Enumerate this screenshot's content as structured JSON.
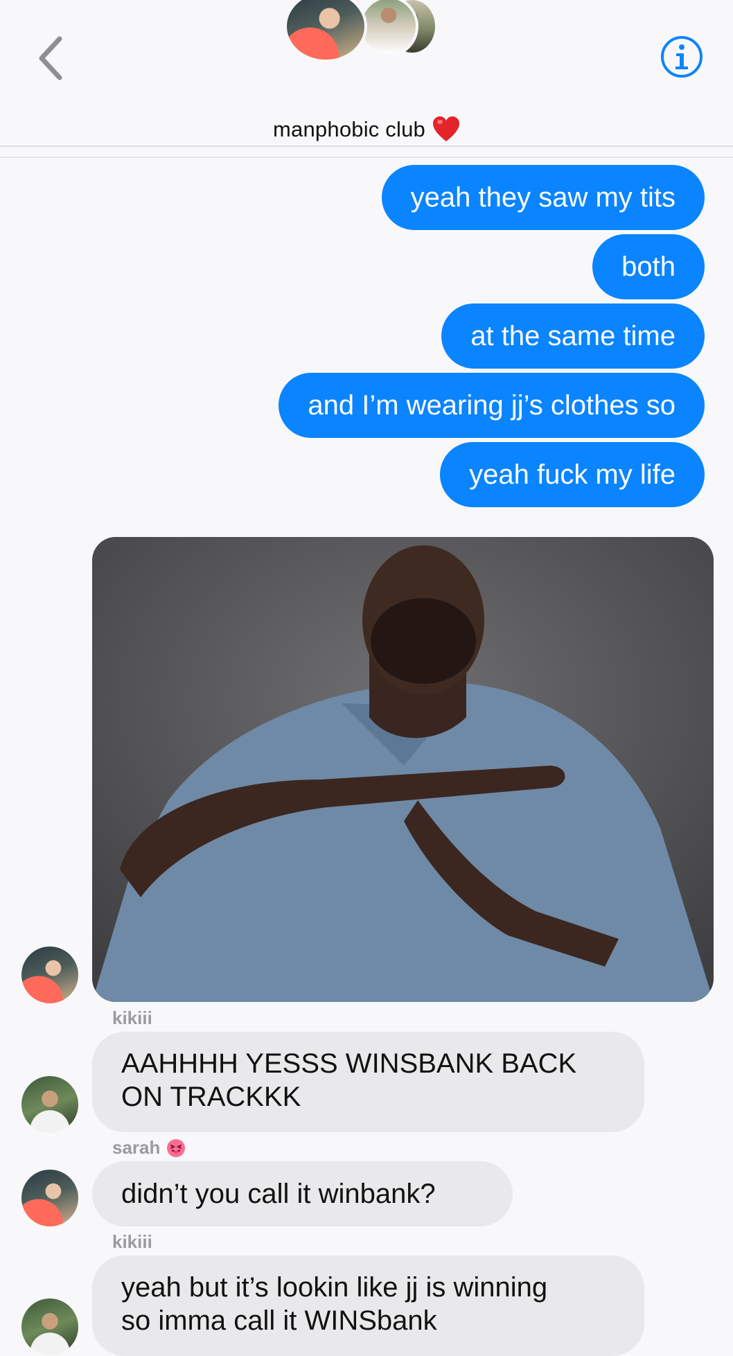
{
  "header": {
    "group_name": "manphobic club",
    "group_emoji": "❤️",
    "back_icon": "chevron-left-icon",
    "info_icon": "info-circle-icon",
    "accent_color": "#0b84ff"
  },
  "messages_out": [
    {
      "text": "yeah they saw my tits"
    },
    {
      "text": "both"
    },
    {
      "text": "at the same time"
    },
    {
      "text": "and I’m wearing jj’s clothes so"
    },
    {
      "text": "yeah fuck my life"
    }
  ],
  "image_message": {
    "description_icon": "meme-photo"
  },
  "messages_in": [
    {
      "sender": "kikiii",
      "sender_emoji": "",
      "lines": [
        "AAHHHH YESSS WINSBANK BACK",
        "ON TRACKKK"
      ]
    },
    {
      "sender": "sarah",
      "sender_emoji": "😝",
      "lines": [
        "didn’t you call it winbank?"
      ]
    },
    {
      "sender": "kikiii",
      "sender_emoji": "",
      "lines": [
        "yeah but it’s lookin like jj is winning",
        "so imma call it WINSbank"
      ]
    }
  ],
  "colors": {
    "outgoing_bubble": "#0b84ff",
    "incoming_bubble": "#e9e9eb",
    "background": "#f8f8fa"
  }
}
